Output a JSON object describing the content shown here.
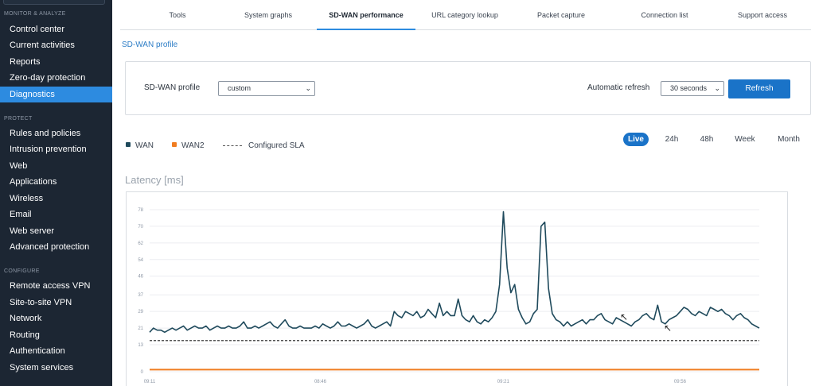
{
  "sidebar": {
    "sections": [
      {
        "title": "MONITOR & ANALYZE",
        "items": [
          "Control center",
          "Current activities",
          "Reports",
          "Zero-day protection",
          "Diagnostics"
        ]
      },
      {
        "title": "PROTECT",
        "items": [
          "Rules and policies",
          "Intrusion prevention",
          "Web",
          "Applications",
          "Wireless",
          "Email",
          "Web server",
          "Advanced protection"
        ]
      },
      {
        "title": "CONFIGURE",
        "items": [
          "Remote access VPN",
          "Site-to-site VPN",
          "Network",
          "Routing",
          "Authentication",
          "System services"
        ]
      }
    ],
    "active_item": "Diagnostics"
  },
  "tabs": [
    "Tools",
    "System graphs",
    "SD-WAN performance",
    "URL category lookup",
    "Packet capture",
    "Connection list",
    "Support access"
  ],
  "active_tab": "SD-WAN performance",
  "subtitle": "SD-WAN profile",
  "panel": {
    "profile_label": "SD-WAN profile",
    "profile_value": "custom",
    "refresh_label": "Automatic refresh",
    "refresh_value": "30 seconds",
    "refresh_button": "Refresh"
  },
  "legend": {
    "wan": "WAN",
    "wan2": "WAN2",
    "sla": "Configured SLA"
  },
  "ranges": [
    "Live",
    "24h",
    "48h",
    "Week",
    "Month"
  ],
  "active_range": "Live",
  "colors": {
    "accent": "#1a73c8",
    "sidebar_active": "#2d8be0",
    "wan": "#1f4a5c",
    "wan2": "#f07d21",
    "sla": "#555555"
  },
  "chart_data": {
    "type": "line",
    "title": "Latency [ms]",
    "ylim": [
      0,
      78
    ],
    "yticks": [
      0,
      13,
      21,
      29,
      37,
      46,
      54,
      62,
      70,
      78
    ],
    "xticks": [
      "09:11",
      "08:46",
      "09:21",
      "09:56"
    ],
    "sla_value": 15,
    "wan2_value": 1,
    "series": [
      {
        "name": "WAN",
        "values": [
          19,
          21,
          20,
          20,
          19,
          20,
          21,
          20,
          21,
          22,
          20,
          21,
          22,
          21,
          21,
          22,
          20,
          21,
          22,
          21,
          21,
          22,
          21,
          21,
          22,
          24,
          21,
          21,
          22,
          21,
          22,
          23,
          24,
          22,
          21,
          23,
          25,
          22,
          21,
          21,
          22,
          21,
          21,
          21,
          22,
          21,
          23,
          22,
          21,
          22,
          24,
          22,
          22,
          23,
          22,
          21,
          22,
          23,
          25,
          22,
          21,
          22,
          23,
          24,
          22,
          29,
          27,
          26,
          29,
          28,
          27,
          29,
          26,
          27,
          30,
          28,
          26,
          33,
          27,
          29,
          27,
          27,
          35,
          27,
          25,
          24,
          27,
          24,
          23,
          25,
          24,
          26,
          29,
          42,
          77,
          50,
          38,
          42,
          30,
          26,
          23,
          24,
          28,
          30,
          70,
          72,
          40,
          28,
          25,
          24,
          22,
          24,
          22,
          23,
          24,
          25,
          23,
          25,
          25,
          27,
          28,
          25,
          24,
          23,
          26,
          25,
          24,
          23,
          22,
          24,
          25,
          27,
          28,
          26,
          25,
          32,
          24,
          23,
          25,
          26,
          27,
          29,
          31,
          30,
          28,
          27,
          29,
          28,
          27,
          31,
          30,
          29,
          30,
          28,
          27,
          25,
          27,
          28,
          26,
          25,
          23,
          22,
          21
        ]
      }
    ]
  }
}
